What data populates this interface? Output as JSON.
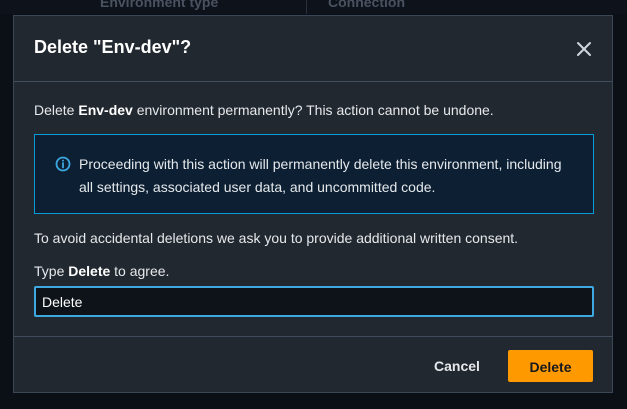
{
  "background": {
    "columns": [
      "Environment type",
      "Connection"
    ]
  },
  "modal": {
    "title": "Delete \"Env-dev\"?",
    "close_icon": "close-icon",
    "body": {
      "prefix": "Delete ",
      "env_name": "Env-dev",
      "suffix": " environment permanently? This action cannot be undone."
    },
    "alert": {
      "icon": "info-icon",
      "text": "Proceeding with this action will permanently delete this environment, including all settings, associated user data, and uncommitted code."
    },
    "consent_text": "To avoid accidental deletions we ask you to provide additional written consent.",
    "type_label": {
      "prefix": "Type ",
      "keyword": "Delete",
      "suffix": " to agree."
    },
    "input": {
      "value": "Delete",
      "placeholder": ""
    },
    "footer": {
      "cancel_label": "Cancel",
      "delete_label": "Delete"
    }
  },
  "colors": {
    "accent": "#ff9900",
    "info": "#0a9bd8",
    "input_focus": "#3ea8e0",
    "modal_bg": "#22282f"
  }
}
